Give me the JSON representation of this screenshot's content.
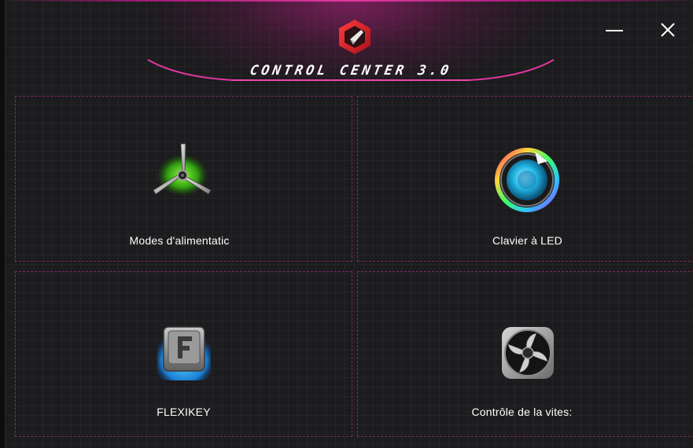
{
  "app": {
    "title": "CONTROL CENTER 3.0"
  },
  "window_controls": {
    "minimize_icon": "minimize-icon",
    "close_icon": "close-icon"
  },
  "tiles": [
    {
      "label": "Modes d'alimentatic",
      "icon": "fan-propeller-icon"
    },
    {
      "label": "Clavier à LED",
      "icon": "led-keyboard-icon"
    },
    {
      "label": "FLEXIKEY",
      "icon": "flexikey-icon"
    },
    {
      "label": "Contrôle de la vites:",
      "icon": "fan-speed-icon"
    }
  ],
  "colors": {
    "accent": "#d8329a",
    "tile_border": "#7a2a64",
    "background": "#1c1b1d",
    "text": "#ffffff"
  }
}
